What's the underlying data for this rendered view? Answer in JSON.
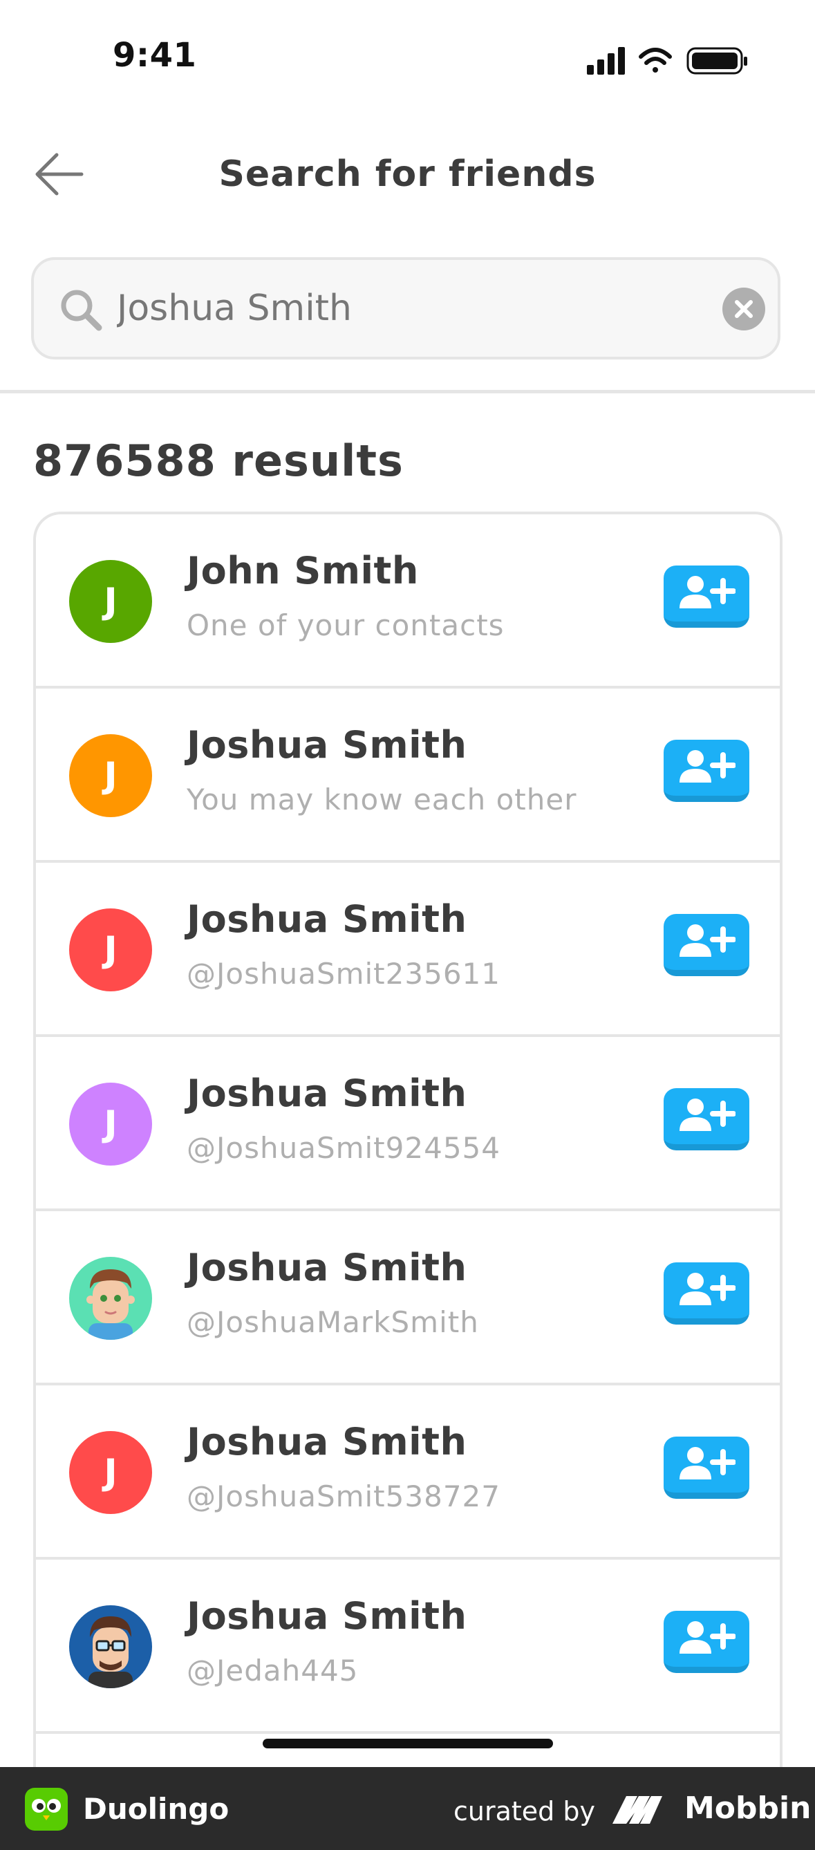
{
  "status_bar": {
    "time": "9:41"
  },
  "header": {
    "title": "Search for friends"
  },
  "search": {
    "value": "Joshua Smith"
  },
  "results": {
    "count_label": "876588 results",
    "items": [
      {
        "name": "John Smith",
        "subtitle": "One of your contacts",
        "avatar": "J",
        "avatar_color": "#58a700"
      },
      {
        "name": "Joshua Smith",
        "subtitle": "You may know each other",
        "avatar": "J",
        "avatar_color": "#ff9600"
      },
      {
        "name": "Joshua Smith",
        "subtitle": "@JoshuaSmit235611",
        "avatar": "J",
        "avatar_color": "#ff4b4b"
      },
      {
        "name": "Joshua Smith",
        "subtitle": "@JoshuaSmit924554",
        "avatar": "J",
        "avatar_color": "#ce82ff"
      },
      {
        "name": "Joshua Smith",
        "subtitle": "@JoshuaMarkSmith",
        "avatar": "",
        "avatar_color": "#5be0b3"
      },
      {
        "name": "Joshua Smith",
        "subtitle": "@JoshuaSmit538727",
        "avatar": "J",
        "avatar_color": "#ff4b4b"
      },
      {
        "name": "Joshua Smith",
        "subtitle": "@Jedah445",
        "avatar": "",
        "avatar_color": "#1c5fa8"
      }
    ]
  },
  "footer": {
    "app_name": "Duolingo",
    "curated_by": "curated by",
    "brand": "Mobbin"
  },
  "colors": {
    "accent": "#1cb0f6",
    "accent_shadow": "#1899d6",
    "border": "#e5e5e5",
    "muted_text": "#afafaf"
  },
  "icons": [
    "back-arrow-icon",
    "search-icon",
    "clear-icon",
    "add-friend-icon",
    "signal-icon",
    "wifi-icon",
    "battery-icon"
  ]
}
